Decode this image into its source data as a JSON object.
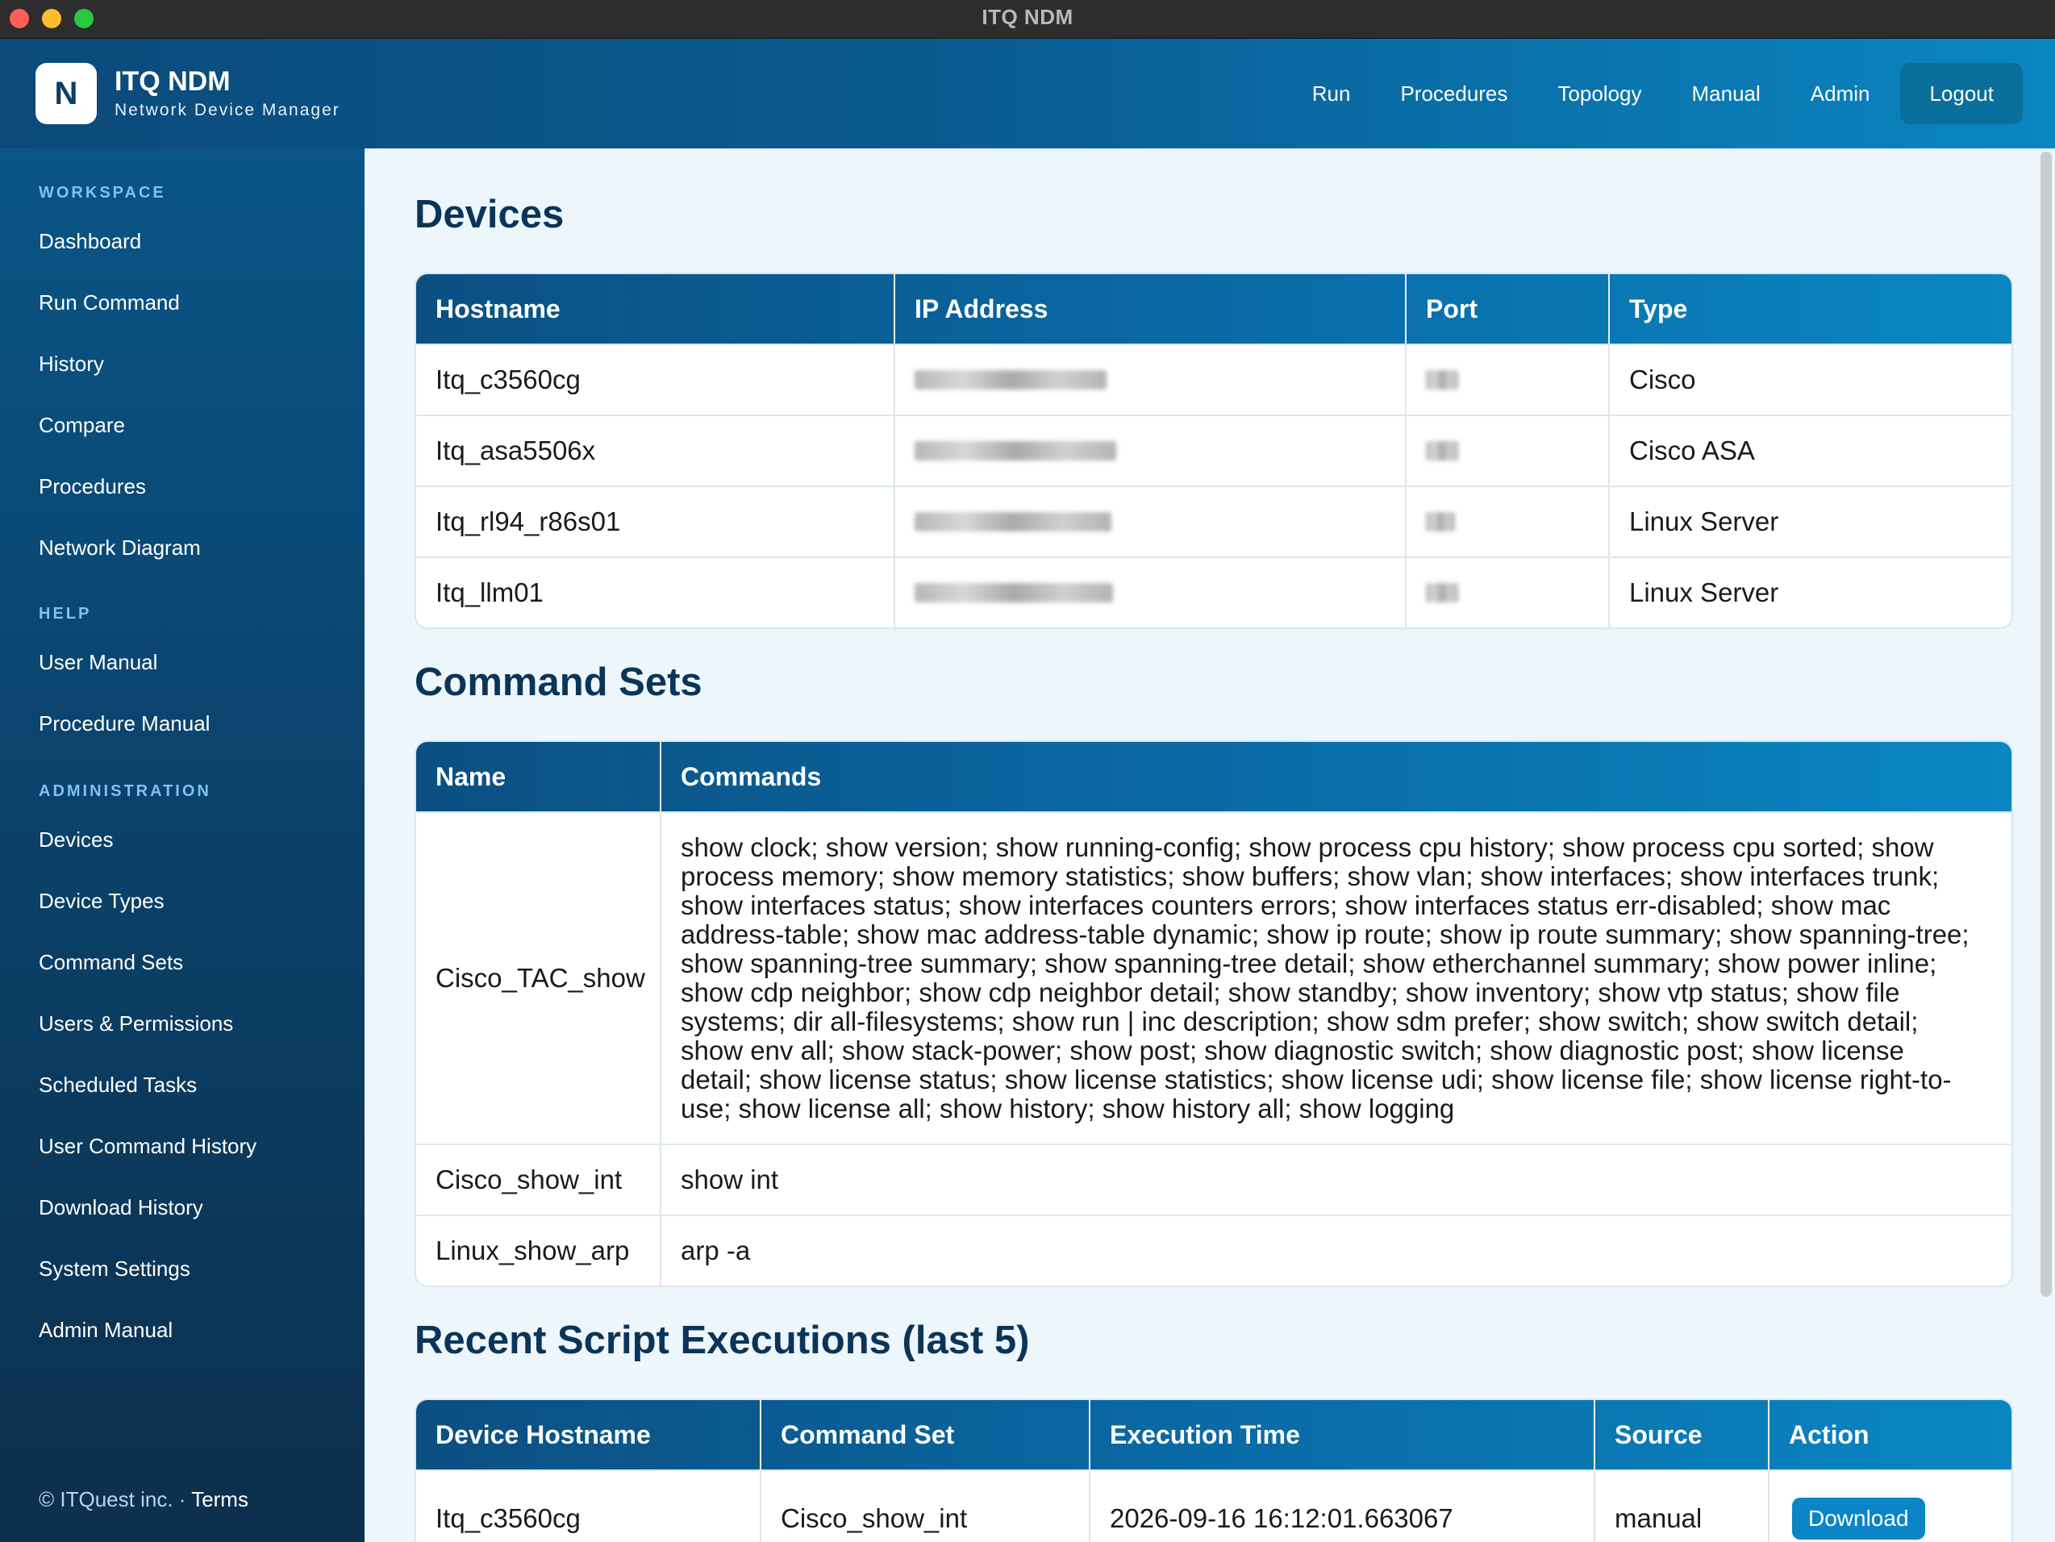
{
  "window": {
    "title": "ITQ NDM"
  },
  "header": {
    "logo_letter": "N",
    "brand_title": "ITQ NDM",
    "brand_subtitle": "Network Device Manager",
    "nav": [
      "Run",
      "Procedures",
      "Topology",
      "Manual",
      "Admin"
    ],
    "logout_label": "Logout"
  },
  "sidebar": {
    "workspace_label": "WORKSPACE",
    "workspace": [
      "Dashboard",
      "Run Command",
      "History",
      "Compare",
      "Procedures",
      "Network Diagram"
    ],
    "help_label": "HELP",
    "help": [
      "User Manual",
      "Procedure Manual"
    ],
    "admin_label": "ADMINISTRATION",
    "admin": [
      "Devices",
      "Device Types",
      "Command Sets",
      "Users & Permissions",
      "Scheduled Tasks",
      "User Command History",
      "Download History",
      "System Settings",
      "Admin Manual"
    ],
    "footer_copyright": "© ITQuest inc. · ",
    "footer_terms": "Terms"
  },
  "devices": {
    "title": "Devices",
    "headers": [
      "Hostname",
      "IP Address",
      "Port",
      "Type"
    ],
    "rows": [
      {
        "hostname": "Itq_c3560cg",
        "type": "Cisco"
      },
      {
        "hostname": "Itq_asa5506x",
        "type": "Cisco ASA"
      },
      {
        "hostname": "Itq_rl94_r86s01",
        "type": "Linux Server"
      },
      {
        "hostname": "Itq_llm01",
        "type": "Linux Server"
      }
    ]
  },
  "command_sets": {
    "title": "Command Sets",
    "headers": [
      "Name",
      "Commands"
    ],
    "rows": [
      {
        "name": "Cisco_TAC_show",
        "commands": "show clock; show version; show running-config; show process cpu history; show process cpu sorted; show process memory; show memory statistics; show buffers; show vlan; show interfaces; show interfaces trunk; show interfaces status; show interfaces counters errors; show interfaces status err-disabled; show mac address-table; show mac address-table dynamic; show ip route; show ip route summary; show spanning-tree; show spanning-tree summary; show spanning-tree detail; show etherchannel summary; show power inline; show cdp neighbor; show cdp neighbor detail; show standby; show inventory; show vtp status; show file systems; dir all-filesystems; show run | inc description; show sdm prefer; show switch; show switch detail; show env all; show stack-power; show post; show diagnostic switch; show diagnostic post; show license detail; show license status; show license statistics; show license udi; show license file; show license right-to-use; show license all; show history; show history all; show logging"
      },
      {
        "name": "Cisco_show_int",
        "commands": "show int"
      },
      {
        "name": "Linux_show_arp",
        "commands": "arp -a"
      }
    ]
  },
  "executions": {
    "title": "Recent Script Executions (last 5)",
    "headers": [
      "Device Hostname",
      "Command Set",
      "Execution Time",
      "Source",
      "Action"
    ],
    "rows": [
      {
        "hostname": "Itq_c3560cg",
        "command_set": "Cisco_show_int",
        "time": "2026-09-16 16:12:01.663067",
        "source": "manual",
        "action": "Download"
      }
    ]
  }
}
